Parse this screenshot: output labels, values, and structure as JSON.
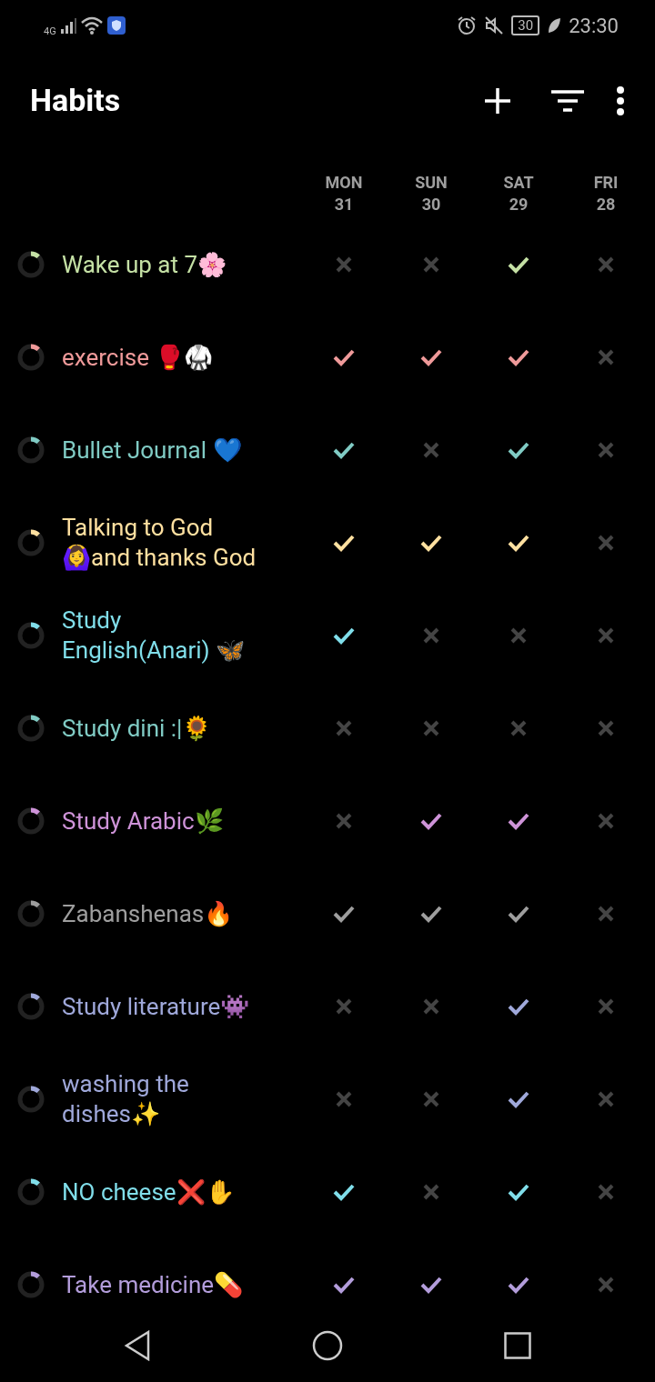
{
  "status_bar": {
    "network": "4G",
    "battery": "30",
    "time": "23:30"
  },
  "toolbar": {
    "title": "Habits"
  },
  "days": [
    {
      "weekday": "MON",
      "date": "31"
    },
    {
      "weekday": "SUN",
      "date": "30"
    },
    {
      "weekday": "SAT",
      "date": "29"
    },
    {
      "weekday": "FRI",
      "date": "28"
    }
  ],
  "habits": [
    {
      "name": "Wake up at 7🌸",
      "color": "#c5e1a5",
      "done": [
        false,
        false,
        true,
        false
      ]
    },
    {
      "name": "exercise 🥊🥋",
      "color": "#ef9a9a",
      "done": [
        true,
        true,
        true,
        false
      ]
    },
    {
      "name": "Bullet Journal 💙",
      "color": "#80cbc4",
      "done": [
        true,
        false,
        true,
        false
      ]
    },
    {
      "name": "Talking to God\n🙆‍♀️and thanks God",
      "color": "#ffe0a0",
      "done": [
        true,
        true,
        true,
        false
      ]
    },
    {
      "name": "Study\nEnglish(Anari) 🦋",
      "color": "#80deea",
      "done": [
        true,
        false,
        false,
        false
      ]
    },
    {
      "name": "Study dini :|🌻",
      "color": "#80cbc4",
      "done": [
        false,
        false,
        false,
        false
      ]
    },
    {
      "name": "Study Arabic🌿",
      "color": "#ce93d8",
      "done": [
        false,
        true,
        true,
        false
      ]
    },
    {
      "name": "Zabanshenas🔥",
      "color": "#9e9e9e",
      "done": [
        true,
        true,
        true,
        false
      ]
    },
    {
      "name": "Study literature👾",
      "color": "#9fa8da",
      "done": [
        false,
        false,
        true,
        false
      ]
    },
    {
      "name": "washing the\ndishes✨",
      "color": "#9fa8da",
      "done": [
        false,
        false,
        true,
        false
      ]
    },
    {
      "name": "NO cheese❌✋",
      "color": "#80deea",
      "done": [
        true,
        false,
        true,
        false
      ]
    },
    {
      "name": "Take medicine💊",
      "color": "#b39ddb",
      "done": [
        true,
        true,
        true,
        false
      ]
    }
  ]
}
